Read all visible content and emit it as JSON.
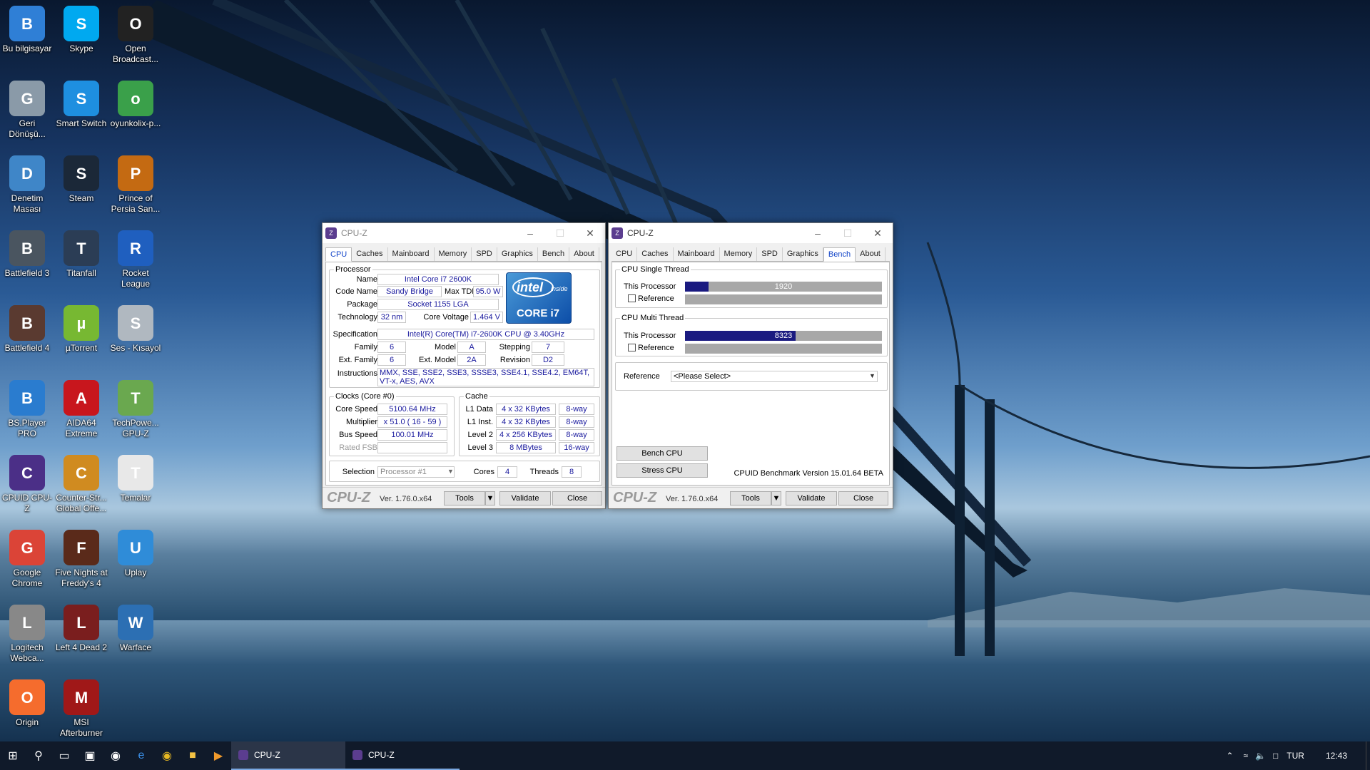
{
  "desktop_icons": [
    {
      "label": "Bu bilgisayar",
      "icon": "computer-icon",
      "color": "#2f7fd6"
    },
    {
      "label": "Skype",
      "icon": "skype-icon",
      "color": "#00a9f0"
    },
    {
      "label": "Open Broadcast...",
      "icon": "obs-icon",
      "color": "#222222"
    },
    {
      "label": "Geri Dönüşü...",
      "icon": "recycle-bin-icon",
      "color": "#8a9aa8"
    },
    {
      "label": "Smart Switch",
      "icon": "smart-switch-icon",
      "color": "#1e8fe0"
    },
    {
      "label": "oyunkolix-p...",
      "icon": "joystick-icon",
      "color": "#3aa04a"
    },
    {
      "label": "Denetim Masası",
      "icon": "control-panel-icon",
      "color": "#3f86c8"
    },
    {
      "label": "Steam",
      "icon": "steam-icon",
      "color": "#1b2838"
    },
    {
      "label": "Prince of Persia San...",
      "icon": "prince-of-persia-icon",
      "color": "#c46a12"
    },
    {
      "label": "Battlefield 3",
      "icon": "battlefield3-icon",
      "color": "#4a5560"
    },
    {
      "label": "Titanfall",
      "icon": "titanfall-icon",
      "color": "#2b3d55"
    },
    {
      "label": "Rocket League",
      "icon": "rocket-league-icon",
      "color": "#1f5fbf"
    },
    {
      "label": "Battlefield 4",
      "icon": "battlefield4-icon",
      "color": "#5a3a30"
    },
    {
      "label": "µTorrent",
      "icon": "utorrent-icon",
      "color": "#77b832"
    },
    {
      "label": "Ses - Kısayol",
      "icon": "speaker-icon",
      "color": "#b0b8c0"
    },
    {
      "label": "BS.Player PRO",
      "icon": "bsplayer-icon",
      "color": "#2a7ccf"
    },
    {
      "label": "AIDA64 Extreme",
      "icon": "aida64-icon",
      "color": "#c8161d"
    },
    {
      "label": "TechPowe... GPU-Z",
      "icon": "gpu-z-icon",
      "color": "#6aa84f"
    },
    {
      "label": "CPUID CPU-Z",
      "icon": "cpu-z-icon",
      "color": "#4b2f87"
    },
    {
      "label": "Counter-Str... Global Offe...",
      "icon": "csgo-icon",
      "color": "#d08b20"
    },
    {
      "label": "Temalar",
      "icon": "document-icon",
      "color": "#e8e8e8"
    },
    {
      "label": "Google Chrome",
      "icon": "chrome-icon",
      "color": "#db4437"
    },
    {
      "label": "Five Nights at Freddy's 4",
      "icon": "fnaf4-icon",
      "color": "#5a2a1a"
    },
    {
      "label": "Uplay",
      "icon": "uplay-icon",
      "color": "#2f8cd8"
    },
    {
      "label": "Logitech Webca...",
      "icon": "webcam-icon",
      "color": "#888888"
    },
    {
      "label": "Left 4 Dead 2",
      "icon": "left4dead2-icon",
      "color": "#7a1e1e"
    },
    {
      "label": "Warface",
      "icon": "warface-icon",
      "color": "#2c6fb3"
    },
    {
      "label": "Origin",
      "icon": "origin-icon",
      "color": "#f56c2d"
    },
    {
      "label": "MSI Afterburner",
      "icon": "msi-afterburner-icon",
      "color": "#a01818"
    }
  ],
  "cpuz_common": {
    "title": "CPU-Z",
    "tabs": [
      "CPU",
      "Caches",
      "Mainboard",
      "Memory",
      "SPD",
      "Graphics",
      "Bench",
      "About"
    ],
    "brand": "CPU-Z",
    "version": "Ver. 1.76.0.x64",
    "tools": "Tools",
    "validate": "Validate",
    "close": "Close"
  },
  "cpu_tab": {
    "processor_legend": "Processor",
    "name_label": "Name",
    "name": "Intel Core i7 2600K",
    "codename_label": "Code Name",
    "codename": "Sandy Bridge",
    "maxtdp_label": "Max TDP",
    "maxtdp": "95.0 W",
    "package_label": "Package",
    "package": "Socket 1155 LGA",
    "technology_label": "Technology",
    "technology": "32 nm",
    "corevoltage_label": "Core Voltage",
    "corevoltage": "1.464 V",
    "spec_label": "Specification",
    "spec": "Intel(R) Core(TM) i7-2600K CPU @ 3.40GHz",
    "family_label": "Family",
    "family": "6",
    "model_label": "Model",
    "model": "A",
    "stepping_label": "Stepping",
    "stepping": "7",
    "extfamily_label": "Ext. Family",
    "extfamily": "6",
    "extmodel_label": "Ext. Model",
    "extmodel": "2A",
    "revision_label": "Revision",
    "revision": "D2",
    "instructions_label": "Instructions",
    "instructions": "MMX, SSE, SSE2, SSE3, SSSE3, SSE4.1, SSE4.2, EM64T, VT-x, AES, AVX",
    "logo_brand": "intel",
    "logo_inside": "inside",
    "logo_core": "CORE i7",
    "clocks_legend": "Clocks (Core #0)",
    "corespeed_label": "Core Speed",
    "corespeed": "5100.64 MHz",
    "multiplier_label": "Multiplier",
    "multiplier": "x 51.0 ( 16 - 59 )",
    "busspeed_label": "Bus Speed",
    "busspeed": "100.01 MHz",
    "ratedfsb_label": "Rated FSB",
    "ratedfsb": "",
    "cache_legend": "Cache",
    "l1data_label": "L1 Data",
    "l1data": "4 x 32 KBytes",
    "l1data_way": "8-way",
    "l1inst_label": "L1 Inst.",
    "l1inst": "4 x 32 KBytes",
    "l1inst_way": "8-way",
    "level2_label": "Level 2",
    "level2": "4 x 256 KBytes",
    "level2_way": "8-way",
    "level3_label": "Level 3",
    "level3": "8 MBytes",
    "level3_way": "16-way",
    "selection_label": "Selection",
    "selection": "Processor #1",
    "cores_label": "Cores",
    "cores": "4",
    "threads_label": "Threads",
    "threads": "8"
  },
  "bench_tab": {
    "single_legend": "CPU Single Thread",
    "multi_legend": "CPU Multi Thread",
    "this_processor_label": "This Processor",
    "reference_label": "Reference",
    "single_score": "1920",
    "single_fraction": 0.12,
    "multi_score": "8323",
    "multi_fraction": 0.56,
    "reference_select_label": "Reference",
    "reference_select_value": "<Please Select>",
    "bench_cpu": "Bench CPU",
    "stress_cpu": "Stress CPU",
    "benchmark_version": "CPUID Benchmark Version 15.01.64 BETA"
  },
  "taskbar": {
    "apps": [
      "CPU-Z",
      "CPU-Z"
    ],
    "language": "TUR",
    "time": "12:43"
  },
  "colors": {
    "accent": "#1244c8",
    "value_text": "#1a1a9e",
    "bench_bar": "#1a1a80"
  }
}
